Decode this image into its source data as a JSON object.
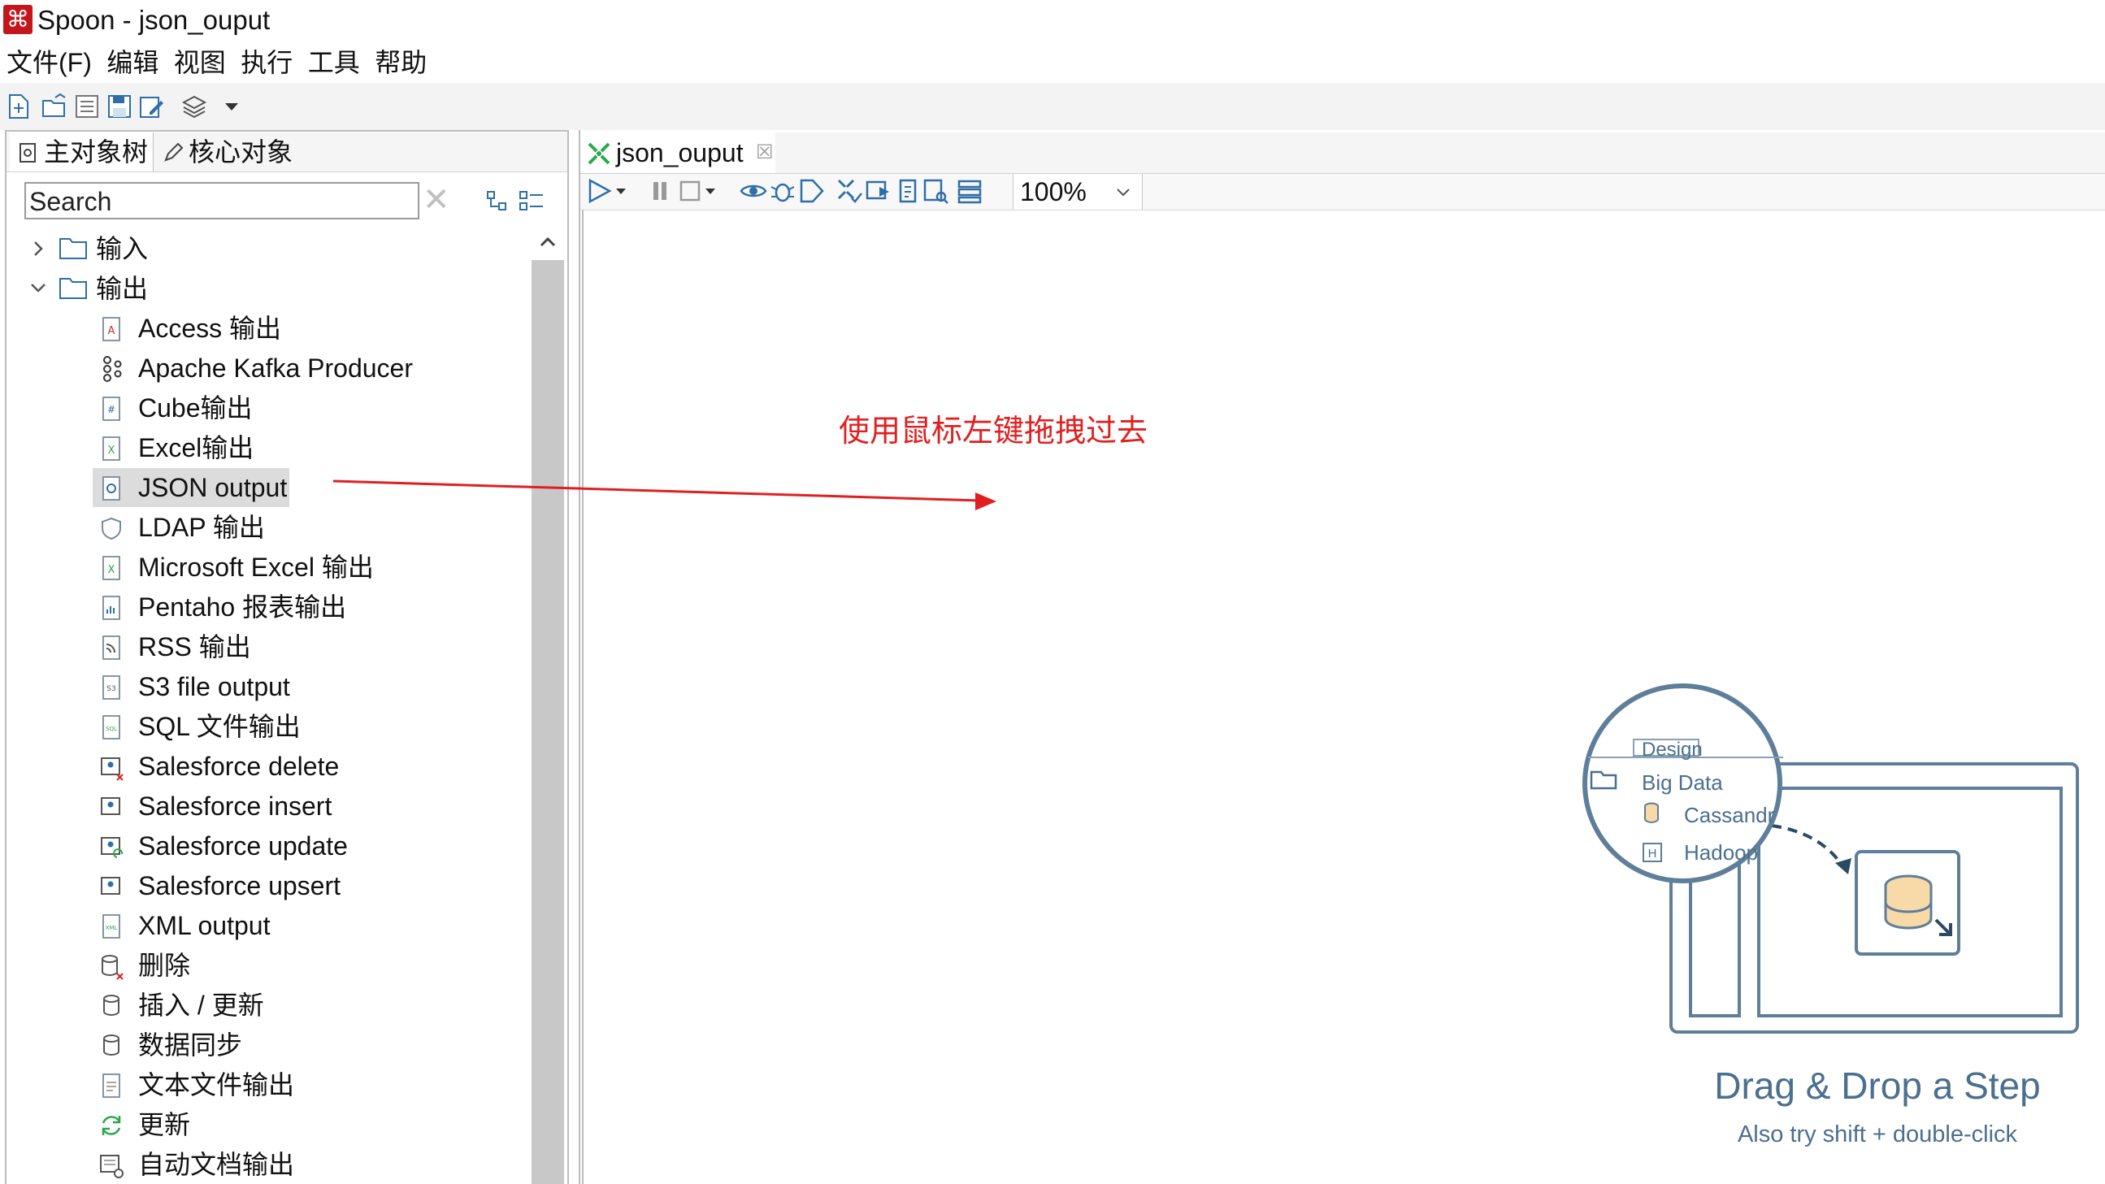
{
  "window": {
    "title": "Spoon - json_ouput"
  },
  "menu": [
    "文件(F)",
    "编辑",
    "视图",
    "执行",
    "工具",
    "帮助"
  ],
  "left_panel": {
    "tabs": [
      "主对象树",
      "核心对象"
    ],
    "search": {
      "value": "Search"
    },
    "tree": {
      "folders": [
        {
          "label": "输入",
          "expanded": false
        },
        {
          "label": "输出",
          "expanded": true
        }
      ],
      "items": [
        {
          "label": "Access 输出",
          "icon": "access-output-icon",
          "selected": false
        },
        {
          "label": "Apache Kafka Producer",
          "icon": "kafka-producer-icon",
          "selected": false
        },
        {
          "label": "Cube输出",
          "icon": "cube-output-icon",
          "selected": false
        },
        {
          "label": "Excel输出",
          "icon": "excel-output-icon",
          "selected": false
        },
        {
          "label": "JSON output",
          "icon": "json-output-icon",
          "selected": true
        },
        {
          "label": "LDAP 输出",
          "icon": "ldap-output-icon",
          "selected": false
        },
        {
          "label": "Microsoft Excel 输出",
          "icon": "ms-excel-output-icon",
          "selected": false
        },
        {
          "label": "Pentaho 报表输出",
          "icon": "pentaho-report-output-icon",
          "selected": false
        },
        {
          "label": "RSS 输出",
          "icon": "rss-output-icon",
          "selected": false
        },
        {
          "label": "S3 file output",
          "icon": "s3-file-output-icon",
          "selected": false
        },
        {
          "label": "SQL 文件输出",
          "icon": "sql-file-output-icon",
          "selected": false
        },
        {
          "label": "Salesforce delete",
          "icon": "salesforce-delete-icon",
          "selected": false
        },
        {
          "label": "Salesforce insert",
          "icon": "salesforce-insert-icon",
          "selected": false
        },
        {
          "label": "Salesforce update",
          "icon": "salesforce-update-icon",
          "selected": false
        },
        {
          "label": "Salesforce upsert",
          "icon": "salesforce-upsert-icon",
          "selected": false
        },
        {
          "label": "XML output",
          "icon": "xml-output-icon",
          "selected": false
        },
        {
          "label": "删除",
          "icon": "delete-icon",
          "selected": false
        },
        {
          "label": "插入 / 更新",
          "icon": "insert-update-icon",
          "selected": false
        },
        {
          "label": "数据同步",
          "icon": "data-sync-icon",
          "selected": false
        },
        {
          "label": "文本文件输出",
          "icon": "text-file-output-icon",
          "selected": false
        },
        {
          "label": "更新",
          "icon": "update-icon",
          "selected": false
        },
        {
          "label": "自动文档输出",
          "icon": "auto-doc-output-icon",
          "selected": false
        }
      ]
    }
  },
  "editor": {
    "tab_label": "json_ouput",
    "zoom": "100%"
  },
  "annotation": {
    "text": "使用鼠标左键拖拽过去",
    "color": "#e02020"
  },
  "hint": {
    "title": "Drag & Drop a Step",
    "subtitle": "Also try shift + double-click",
    "illustration": {
      "tab": "Design",
      "folder": "Big Data",
      "items": [
        "Cassandr",
        "Hadoop"
      ]
    }
  },
  "colors": {
    "brand": "#c4161c",
    "hint": "#4a6f8f",
    "icon_blue": "#2f6ea8",
    "icon_green": "#2aa84a"
  }
}
